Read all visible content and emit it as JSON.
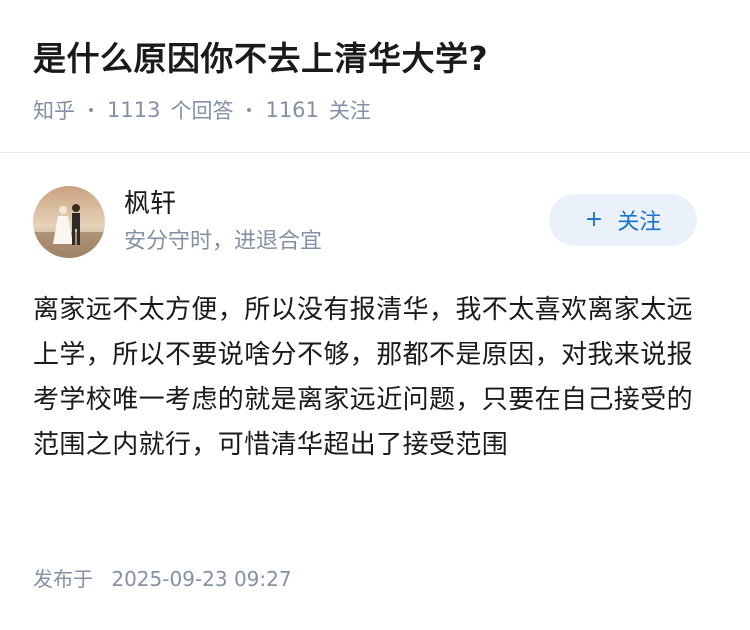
{
  "question": {
    "title": "是什么原因你不去上清华大学?",
    "source": "知乎",
    "answer_count": "1113",
    "answer_label": "个回答",
    "follower_count": "1161",
    "follower_label": "关注"
  },
  "author": {
    "name": "枫轩",
    "bio": "安分守时，进退合宜",
    "follow_label": "关注",
    "follow_icon": "plus-icon"
  },
  "answer": {
    "content": "离家远不太方便，所以没有报清华，我不太喜欢离家太远上学，所以不要说啥分不够，那都不是原因，对我来说报考学校唯一考虑的就是离家远近问题，只要在自己接受的范围之内就行，可惜清华超出了接受范围"
  },
  "publish": {
    "label": "发布于",
    "datetime": "2025-09-23 09:27"
  },
  "colors": {
    "title": "#1a1a1a",
    "meta": "#8590a6",
    "accent": "#1772d0",
    "follow_bg": "#eaf1fb"
  }
}
